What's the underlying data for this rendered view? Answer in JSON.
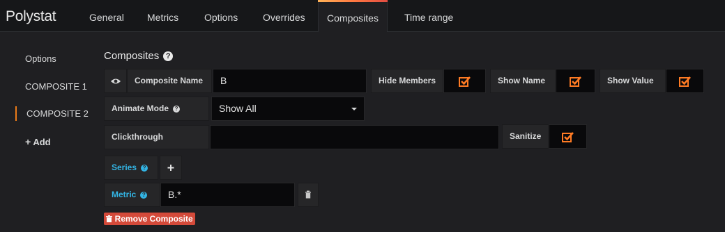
{
  "app": {
    "title": "Polystat"
  },
  "tabs": [
    {
      "label": "General"
    },
    {
      "label": "Metrics"
    },
    {
      "label": "Options"
    },
    {
      "label": "Overrides"
    },
    {
      "label": "Composites",
      "active": true
    },
    {
      "label": "Time range"
    }
  ],
  "sidebar": {
    "items": [
      {
        "label": "Options"
      },
      {
        "label": "COMPOSITE 1"
      },
      {
        "label": "COMPOSITE 2",
        "active": true
      },
      {
        "label": "Add",
        "icon": "plus-icon"
      }
    ]
  },
  "composites": {
    "title": "Composites",
    "help_glyph": "?",
    "composite_name": {
      "label": "Composite Name",
      "value": "B"
    },
    "hide_members": {
      "label": "Hide Members",
      "checked": true
    },
    "show_name": {
      "label": "Show Name",
      "checked": true
    },
    "show_value": {
      "label": "Show Value",
      "checked": true
    },
    "animate_mode": {
      "label": "Animate Mode",
      "value": "Show All"
    },
    "clickthrough": {
      "label": "Clickthrough",
      "value": ""
    },
    "sanitize": {
      "label": "Sanitize",
      "checked": true
    },
    "series": {
      "label": "Series"
    },
    "metric": {
      "label": "Metric",
      "value": "B.*"
    },
    "remove_label": "Remove Composite"
  },
  "colors": {
    "accent": "#eb7b18",
    "checkbox": "#ff7b24",
    "link_blue": "#33b5e5",
    "danger": "#d44a3a",
    "background": "#1f1f22",
    "input_bg": "#09090b"
  }
}
